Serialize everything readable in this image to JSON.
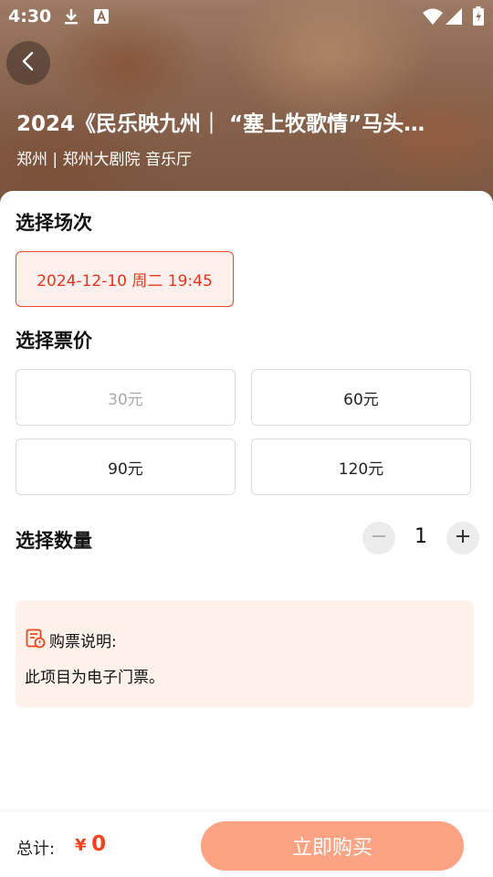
{
  "status_bar": {
    "time": "4:30"
  },
  "event": {
    "title": "2024《民乐映九州｜ “塞上牧歌情”马头…",
    "venue": "郑州 | 郑州大剧院 音乐厅"
  },
  "session": {
    "label": "选择场次",
    "options": [
      "2024-12-10 周二 19:45"
    ],
    "selected_index": 0
  },
  "price": {
    "label": "选择票价",
    "options": [
      "30元",
      "60元",
      "90元",
      "120元"
    ],
    "disabled": [
      "30元"
    ]
  },
  "quantity": {
    "label": "选择数量",
    "value": "1"
  },
  "notice": {
    "title": "购票说明:",
    "body": "此项目为电子门票。"
  },
  "footer": {
    "total_label": "总计:",
    "currency": "¥",
    "amount": "0",
    "buy_label": "立即购买"
  },
  "colors": {
    "accent": "#e2371c",
    "buy_button": "#fba382",
    "notice_bg": "#fff2ea"
  },
  "icons": [
    "download-icon",
    "a-text-icon",
    "wifi-icon",
    "signal-icon",
    "battery-icon",
    "back-arrow-icon",
    "minus-icon",
    "plus-icon",
    "ticket-notice-icon"
  ]
}
